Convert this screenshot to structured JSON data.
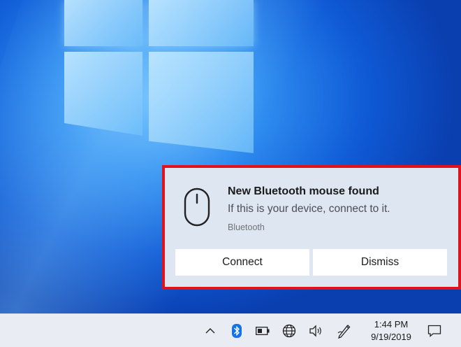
{
  "notification": {
    "title": "New Bluetooth mouse found",
    "message": "If this is your device, connect to it.",
    "source": "Bluetooth",
    "buttons": {
      "connect": "Connect",
      "dismiss": "Dismiss"
    },
    "icon": "mouse-icon",
    "highlight_color": "#e0121b"
  },
  "taskbar": {
    "tray_icons": [
      "chevron-up-icon",
      "bluetooth-icon",
      "battery-icon",
      "network-icon",
      "volume-icon",
      "pen-icon"
    ],
    "time": "1:44 PM",
    "date": "9/19/2019",
    "action_center_icon": "action-center-icon"
  },
  "colors": {
    "bluetooth_blue": "#1473e6",
    "toast_background": "#dde6f1",
    "taskbar_background": "#e9edf3"
  }
}
